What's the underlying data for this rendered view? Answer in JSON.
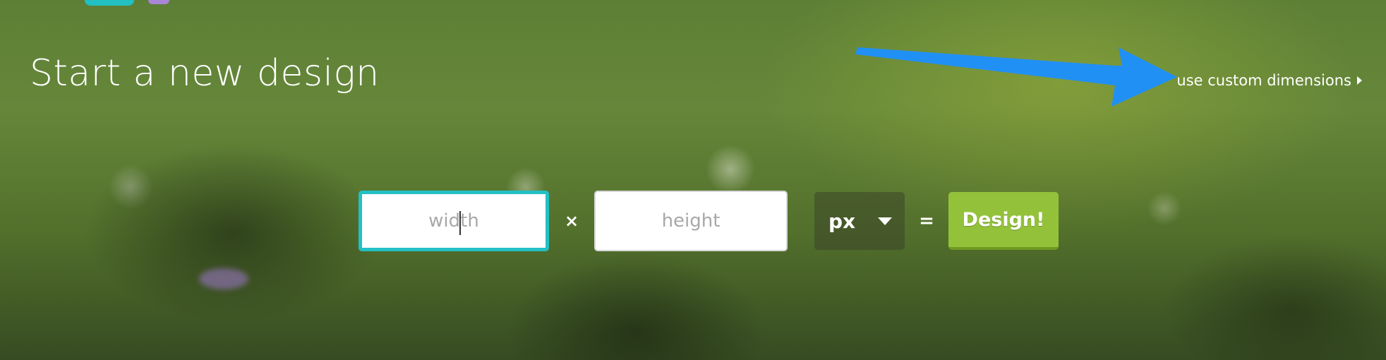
{
  "page": {
    "title": "Start a new design"
  },
  "header": {
    "custom_link_label": "use custom dimensions"
  },
  "form": {
    "width_placeholder": "width",
    "times_symbol": "×",
    "height_placeholder": "height",
    "unit_selected": "px",
    "equals_symbol": "=",
    "submit_label": "Design!"
  },
  "colors": {
    "accent_focus": "#23c0c6",
    "button_green": "#93c23a",
    "annotation_arrow": "#2190f5"
  },
  "icons": [
    "arrow-annotation-icon",
    "chevron-right-icon",
    "dropdown-caret-icon"
  ]
}
